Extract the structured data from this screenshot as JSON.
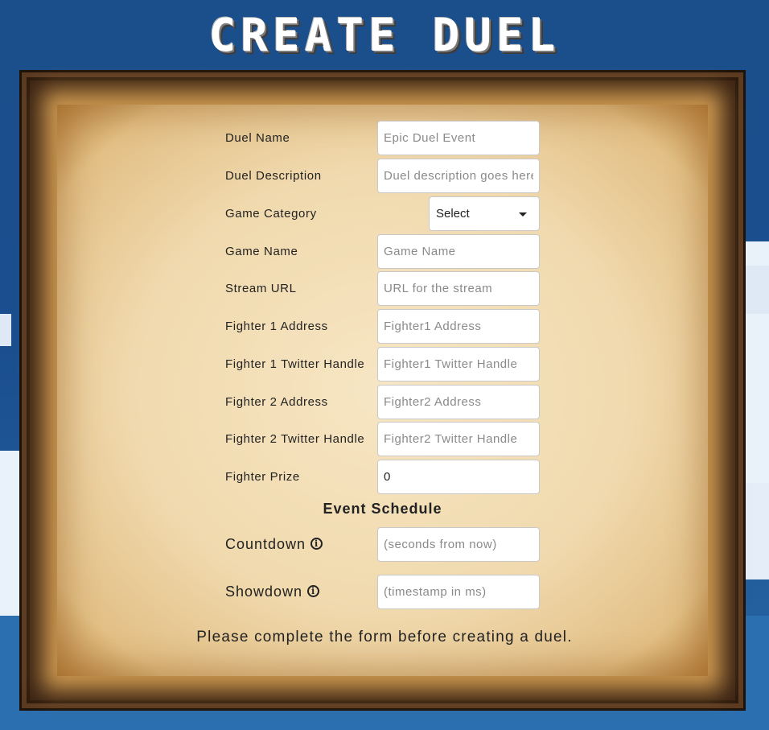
{
  "header": {
    "title": "CREATE DUEL"
  },
  "form": {
    "duel_name": {
      "label": "Duel Name",
      "placeholder": "Epic Duel Event",
      "value": ""
    },
    "duel_description": {
      "label": "Duel Description",
      "placeholder": "Duel description goes here",
      "value": ""
    },
    "game_category": {
      "label": "Game Category",
      "selected": "Select"
    },
    "game_name": {
      "label": "Game Name",
      "placeholder": "Game Name",
      "value": ""
    },
    "stream_url": {
      "label": "Stream URL",
      "placeholder": "URL for the stream",
      "value": ""
    },
    "fighter1_address": {
      "label": "Fighter 1 Address",
      "placeholder": "Fighter1 Address",
      "value": ""
    },
    "fighter1_twitter": {
      "label": "Fighter 1 Twitter Handle",
      "placeholder": "Fighter1 Twitter Handle",
      "value": ""
    },
    "fighter2_address": {
      "label": "Fighter 2 Address",
      "placeholder": "Fighter2 Address",
      "value": ""
    },
    "fighter2_twitter": {
      "label": "Fighter 2 Twitter Handle",
      "placeholder": "Fighter2 Twitter Handle",
      "value": ""
    },
    "fighter_prize": {
      "label": "Fighter Prize",
      "placeholder": "",
      "value": "0"
    }
  },
  "schedule": {
    "title": "Event Schedule",
    "countdown": {
      "label": "Countdown",
      "placeholder": "(seconds from now)",
      "value": ""
    },
    "showdown": {
      "label": "Showdown",
      "placeholder": "(timestamp in ms)",
      "value": ""
    },
    "info_icon": "info-circle-icon"
  },
  "status": {
    "message": "Please complete the form before creating a duel."
  },
  "colors": {
    "background": "#1b4f8c",
    "parchment": "#f0d9ad",
    "frame": "#3b2414",
    "text": "#222222"
  }
}
